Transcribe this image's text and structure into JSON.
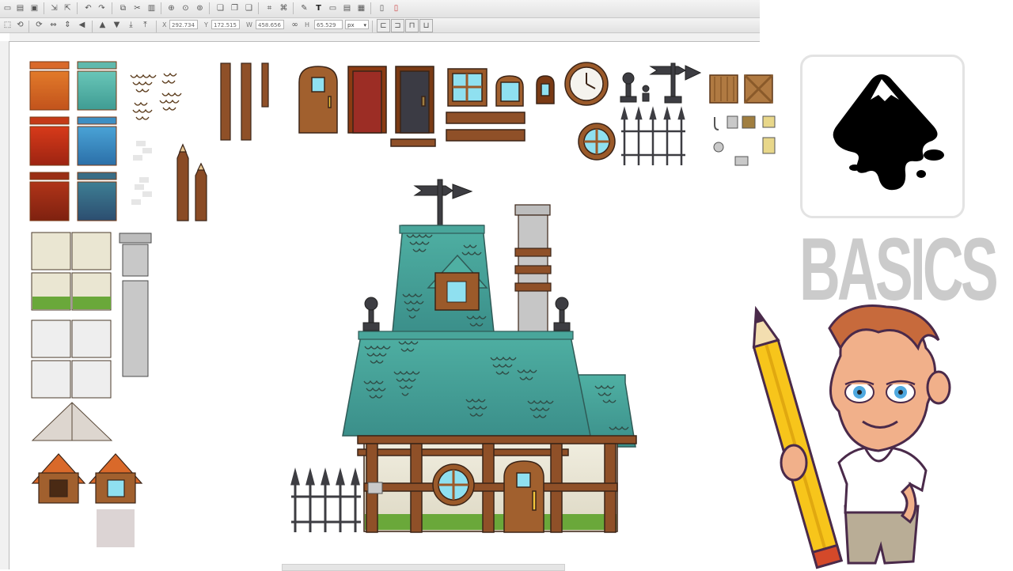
{
  "toolbar": {
    "main_icons": [
      "new-icon",
      "open-icon",
      "save-icon",
      "print-icon",
      "import-icon",
      "export-icon",
      "undo-icon",
      "redo-icon",
      "copy-icon",
      "cut-icon",
      "paste-icon",
      "zoom-selection-icon",
      "zoom-drawing-icon",
      "zoom-page-icon",
      "duplicate-icon",
      "clone-icon",
      "unlink-clone-icon",
      "group-icon",
      "ungroup-icon",
      "fill-stroke-icon",
      "text-font-icon",
      "xml-editor-icon",
      "align-icon",
      "preferences-icon",
      "document-properties-icon"
    ],
    "controls_icons": [
      "select-all-icon",
      "rotate-ccw-icon",
      "rotate-cw-icon",
      "flip-horizontal-icon",
      "flip-vertical-icon",
      "raise-top-icon",
      "raise-icon",
      "lower-icon",
      "lower-bottom-icon"
    ],
    "x_label": "X",
    "x_value": "292.734",
    "y_label": "Y",
    "y_value": "172.515",
    "w_label": "W",
    "w_value": "458.656",
    "h_label": "H",
    "h_value": "65.529",
    "unit_value": "px"
  },
  "logo": {
    "caption": "BASICS",
    "icon": "inkscape-logo-icon"
  },
  "canvas": {
    "scene": "house-assets-illustration"
  },
  "colors": {
    "roof_teal": "#3f9c93",
    "wood_brown": "#8a4b25",
    "outline": "#3b2417",
    "pencil_yellow": "#f7c51b",
    "basics_gray": "#cbcbcb"
  }
}
